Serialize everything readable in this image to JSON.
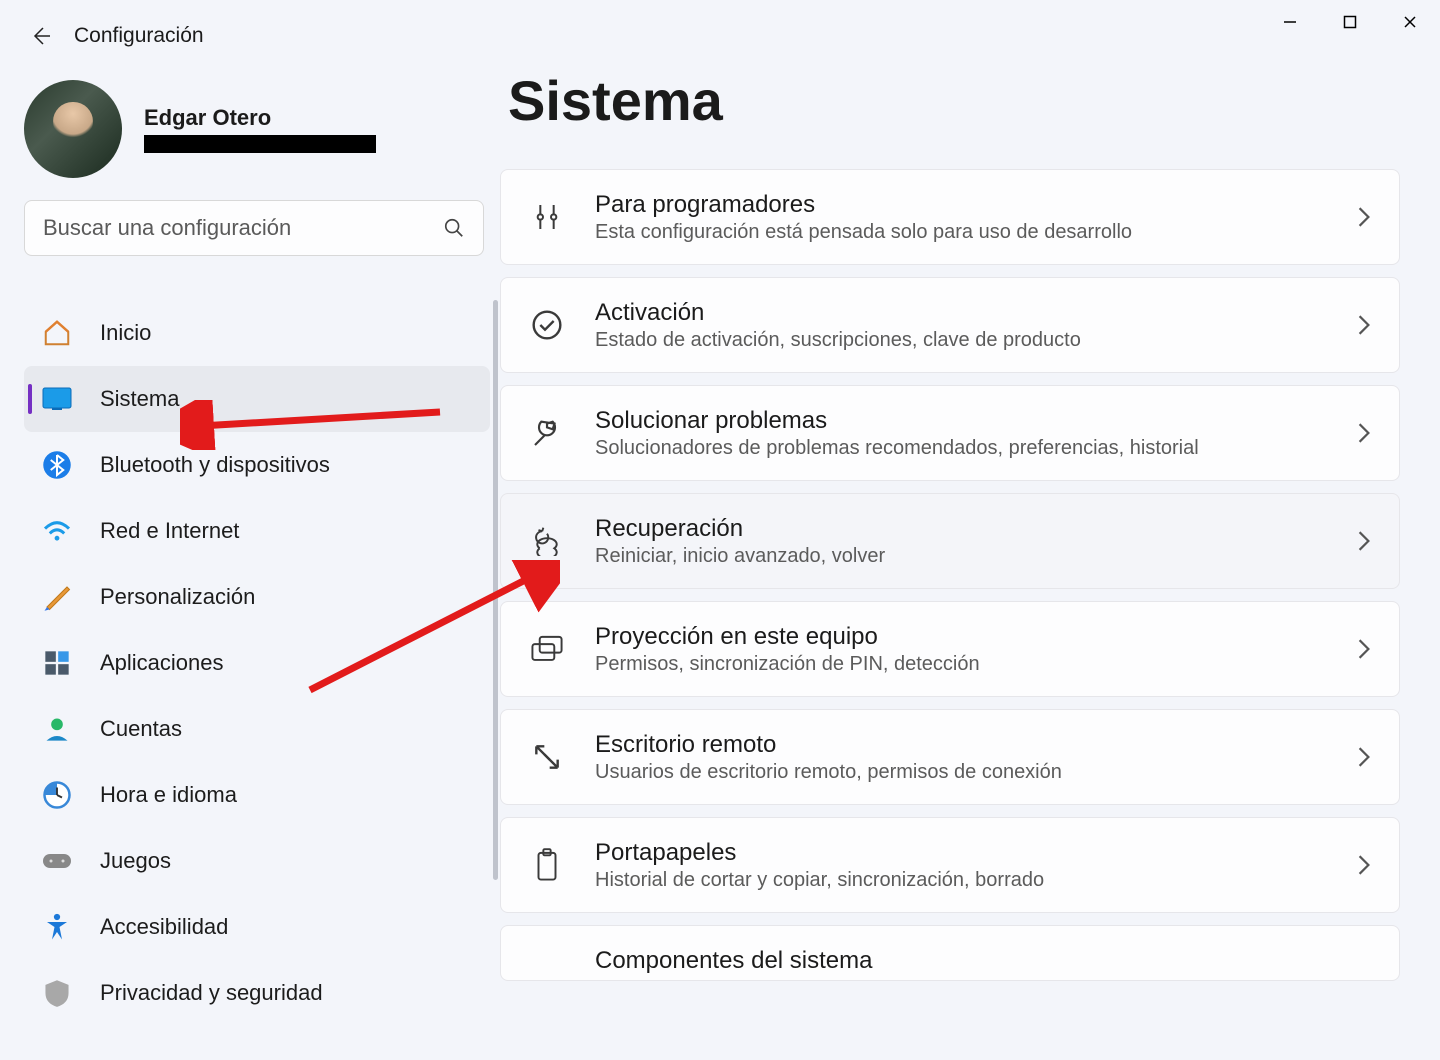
{
  "app_title": "Configuración",
  "window_controls": {
    "min": "—",
    "max": "▢",
    "close": "✕"
  },
  "profile": {
    "name": "Edgar Otero"
  },
  "search": {
    "placeholder": "Buscar una configuración"
  },
  "sidebar": {
    "items": [
      {
        "label": "Inicio",
        "icon": "home"
      },
      {
        "label": "Sistema",
        "icon": "system",
        "active": true
      },
      {
        "label": "Bluetooth y dispositivos",
        "icon": "bluetooth"
      },
      {
        "label": "Red e Internet",
        "icon": "wifi"
      },
      {
        "label": "Personalización",
        "icon": "brush"
      },
      {
        "label": "Aplicaciones",
        "icon": "apps"
      },
      {
        "label": "Cuentas",
        "icon": "account"
      },
      {
        "label": "Hora e idioma",
        "icon": "time"
      },
      {
        "label": "Juegos",
        "icon": "games"
      },
      {
        "label": "Accesibilidad",
        "icon": "accessibility"
      },
      {
        "label": "Privacidad y seguridad",
        "icon": "privacy"
      }
    ]
  },
  "main": {
    "title": "Sistema",
    "cards": [
      {
        "title": "Para programadores",
        "subtitle": "Esta configuración está pensada solo para uso de desarrollo",
        "icon": "developer"
      },
      {
        "title": "Activación",
        "subtitle": "Estado de activación, suscripciones, clave de producto",
        "icon": "check"
      },
      {
        "title": "Solucionar problemas",
        "subtitle": "Solucionadores de problemas recomendados, preferencias, historial",
        "icon": "wrench"
      },
      {
        "title": "Recuperación",
        "subtitle": "Reiniciar, inicio avanzado, volver",
        "icon": "recovery",
        "hover": true
      },
      {
        "title": "Proyección en este equipo",
        "subtitle": "Permisos, sincronización de PIN, detección",
        "icon": "project"
      },
      {
        "title": "Escritorio remoto",
        "subtitle": "Usuarios de escritorio remoto, permisos de conexión",
        "icon": "remote"
      },
      {
        "title": "Portapapeles",
        "subtitle": "Historial de cortar y copiar, sincronización, borrado",
        "icon": "clipboard"
      },
      {
        "title": "Componentes del sistema",
        "subtitle": "",
        "icon": "components"
      }
    ]
  }
}
